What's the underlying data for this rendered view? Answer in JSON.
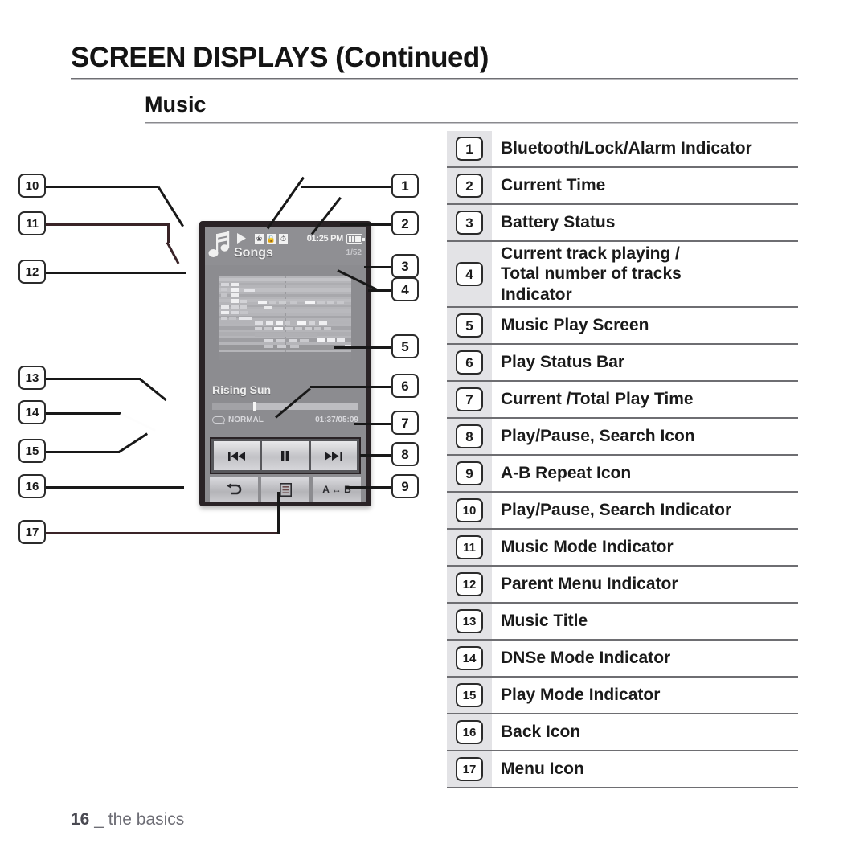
{
  "header": {
    "title": "SCREEN DISPLAYS (Continued)",
    "section": "Music"
  },
  "footer": {
    "page_number": "16",
    "separator": "_",
    "section_name": "the basics"
  },
  "device": {
    "status_bar": {
      "music_mode_icon": "music-note-icon",
      "play_indicator_icon": "play-triangle-icon",
      "bluetooth_icon": "bluetooth-icon",
      "lock_icon": "lock-icon",
      "alarm_icon": "alarm-icon",
      "current_time": "01:25 PM",
      "battery_icon": "battery-full-icon",
      "menu_title": "Songs",
      "track_counter": "1/52"
    },
    "play_screen": {
      "label": "Music Play Screen"
    },
    "song": {
      "title": "Rising Sun",
      "dnse_mode": "NORMAL",
      "repeat_icon": "repeat-icon",
      "play_time": "01:37/05:09",
      "progress_percent": 30
    },
    "transport": [
      {
        "name": "previous-button",
        "glyph": "◀◀|"
      },
      {
        "name": "pause-button",
        "glyph": "‖"
      },
      {
        "name": "next-button",
        "glyph": "|▶▶"
      }
    ],
    "softkeys": [
      {
        "name": "back-button",
        "icon": "back-arrow-icon",
        "label": ""
      },
      {
        "name": "menu-button",
        "icon": "menu-list-icon",
        "label": ""
      },
      {
        "name": "ab-repeat-button",
        "icon": "ab-repeat-icon",
        "label": "A ↔ B"
      }
    ]
  },
  "callouts": {
    "left": [
      "10",
      "11",
      "12",
      "13",
      "14",
      "15",
      "16",
      "17"
    ],
    "right": [
      "1",
      "2",
      "3",
      "4",
      "5",
      "6",
      "7",
      "8",
      "9"
    ]
  },
  "legend": {
    "items": [
      {
        "num": "1",
        "label": "Bluetooth/Lock/Alarm Indicator"
      },
      {
        "num": "2",
        "label": "Current Time"
      },
      {
        "num": "3",
        "label": "Battery Status"
      },
      {
        "num": "4",
        "label": "Current track playing /\nTotal number of tracks\nIndicator"
      },
      {
        "num": "5",
        "label": "Music Play Screen"
      },
      {
        "num": "6",
        "label": "Play Status Bar"
      },
      {
        "num": "7",
        "label": "Current /Total Play Time"
      },
      {
        "num": "8",
        "label": "Play/Pause, Search Icon"
      },
      {
        "num": "9",
        "label": "A-B Repeat Icon"
      },
      {
        "num": "10",
        "label": "Play/Pause, Search Indicator"
      },
      {
        "num": "11",
        "label": "Music Mode Indicator"
      },
      {
        "num": "12",
        "label": "Parent Menu Indicator"
      },
      {
        "num": "13",
        "label": "Music Title"
      },
      {
        "num": "14",
        "label": "DNSe Mode Indicator"
      },
      {
        "num": "15",
        "label": "Play Mode Indicator"
      },
      {
        "num": "16",
        "label": "Back Icon"
      },
      {
        "num": "17",
        "label": "Menu Icon"
      }
    ]
  },
  "colors": {
    "ink": "#1a1a1a",
    "rule": "#6e6e72",
    "num_band": "#e3e3e6",
    "device_frame": "#2a2326",
    "screen_bg": "#8c8c90",
    "viz_bg": "#b5b5b9"
  }
}
